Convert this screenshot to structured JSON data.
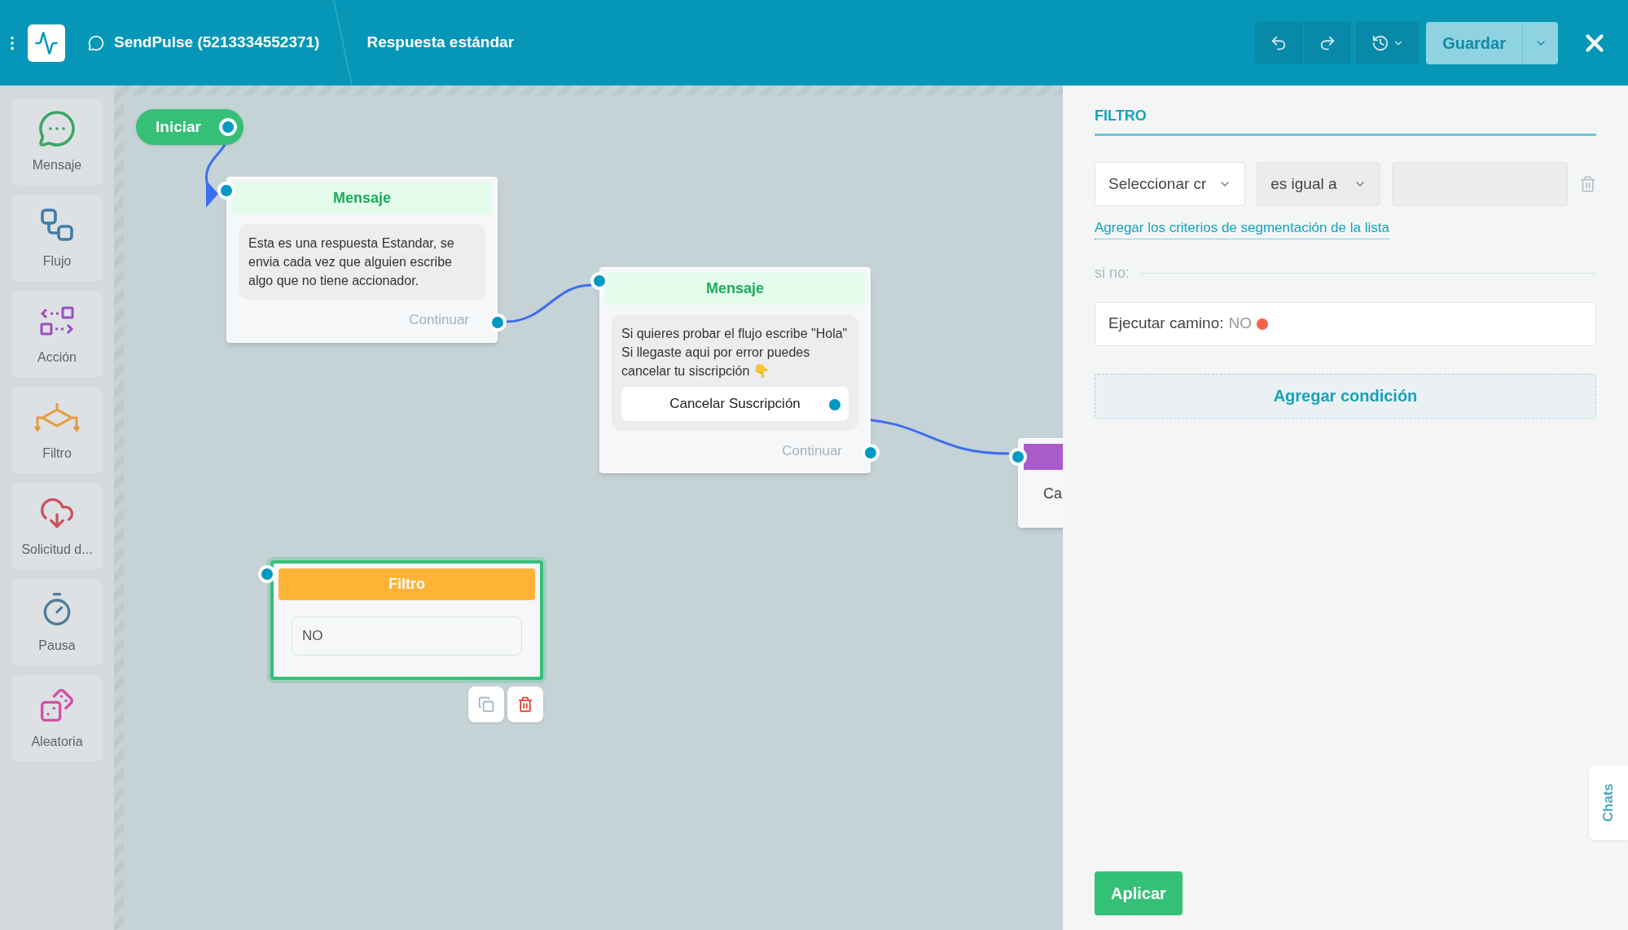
{
  "header": {
    "account": "SendPulse (5213334552371)",
    "flow_name": "Respuesta estándar",
    "save_button": "Guardar"
  },
  "sidebar": {
    "items": [
      {
        "kind": "message",
        "label": "Mensaje"
      },
      {
        "kind": "flow",
        "label": "Flujo"
      },
      {
        "kind": "action",
        "label": "Acción"
      },
      {
        "kind": "filter",
        "label": "Filtro"
      },
      {
        "kind": "request",
        "label": "Solicitud d..."
      },
      {
        "kind": "pause",
        "label": "Pausa"
      },
      {
        "kind": "random",
        "label": "Aleatoria"
      }
    ]
  },
  "canvas": {
    "start": {
      "label": "Iniciar"
    },
    "nodes": [
      {
        "kind": "message",
        "selected": false,
        "title": "Mensaje",
        "text": "Esta es una respuesta Estandar, se envia cada vez que alguien escribe algo que no tiene accionador.",
        "continue": "Continuar"
      },
      {
        "kind": "message",
        "selected": false,
        "title": "Mensaje",
        "text": "Si quieres probar el flujo escribe \"Hola\"\nSi llegaste aqui por error puedes cancelar tu siscripción 👇",
        "buttons": [
          "Cancelar Suscripción"
        ],
        "continue": "Continuar"
      },
      {
        "kind": "action",
        "selected": false,
        "text": "Ca"
      },
      {
        "kind": "filter",
        "selected": true,
        "title": "Filtro",
        "conditions": [
          "NO"
        ]
      }
    ]
  },
  "panel": {
    "title": "FILTRO",
    "criteria_select": "Seleccionar cr",
    "operator_select": "es igual a",
    "segment_link": "Agregar los criterios de segmentación de la lista",
    "else_label": "si no:",
    "else_path": {
      "label": "Ejecutar camino:",
      "value": "NO",
      "color": "#f4634a"
    },
    "add_condition": "Agregar condición",
    "apply_button": "Aplicar"
  },
  "chats_tab": "Chats"
}
